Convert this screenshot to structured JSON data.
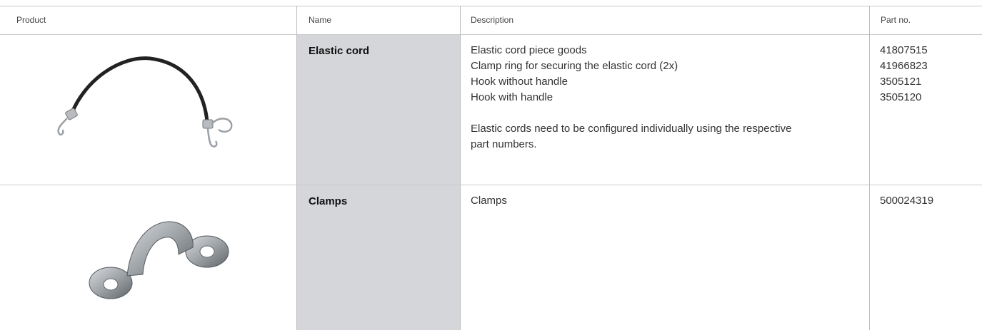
{
  "table": {
    "headers": {
      "product": "Product",
      "name": "Name",
      "description": "Description",
      "part_no": "Part no."
    },
    "rows": [
      {
        "name": "Elastic cord",
        "image": "elastic-cord-with-hooks",
        "description_lines": [
          "Elastic cord piece goods",
          "Clamp ring for securing the elastic cord (2x)",
          "Hook without handle",
          "Hook with handle"
        ],
        "note_line1": "Elastic cords need to be configured individually using the respective",
        "note_line2": "part numbers.",
        "part_numbers": [
          "41807515",
          "41966823",
          "3505121",
          "3505120"
        ]
      },
      {
        "name": "Clamps",
        "image": "metal-clamp",
        "description_lines": [
          "Clamps"
        ],
        "part_numbers": [
          "500024319"
        ]
      }
    ]
  }
}
